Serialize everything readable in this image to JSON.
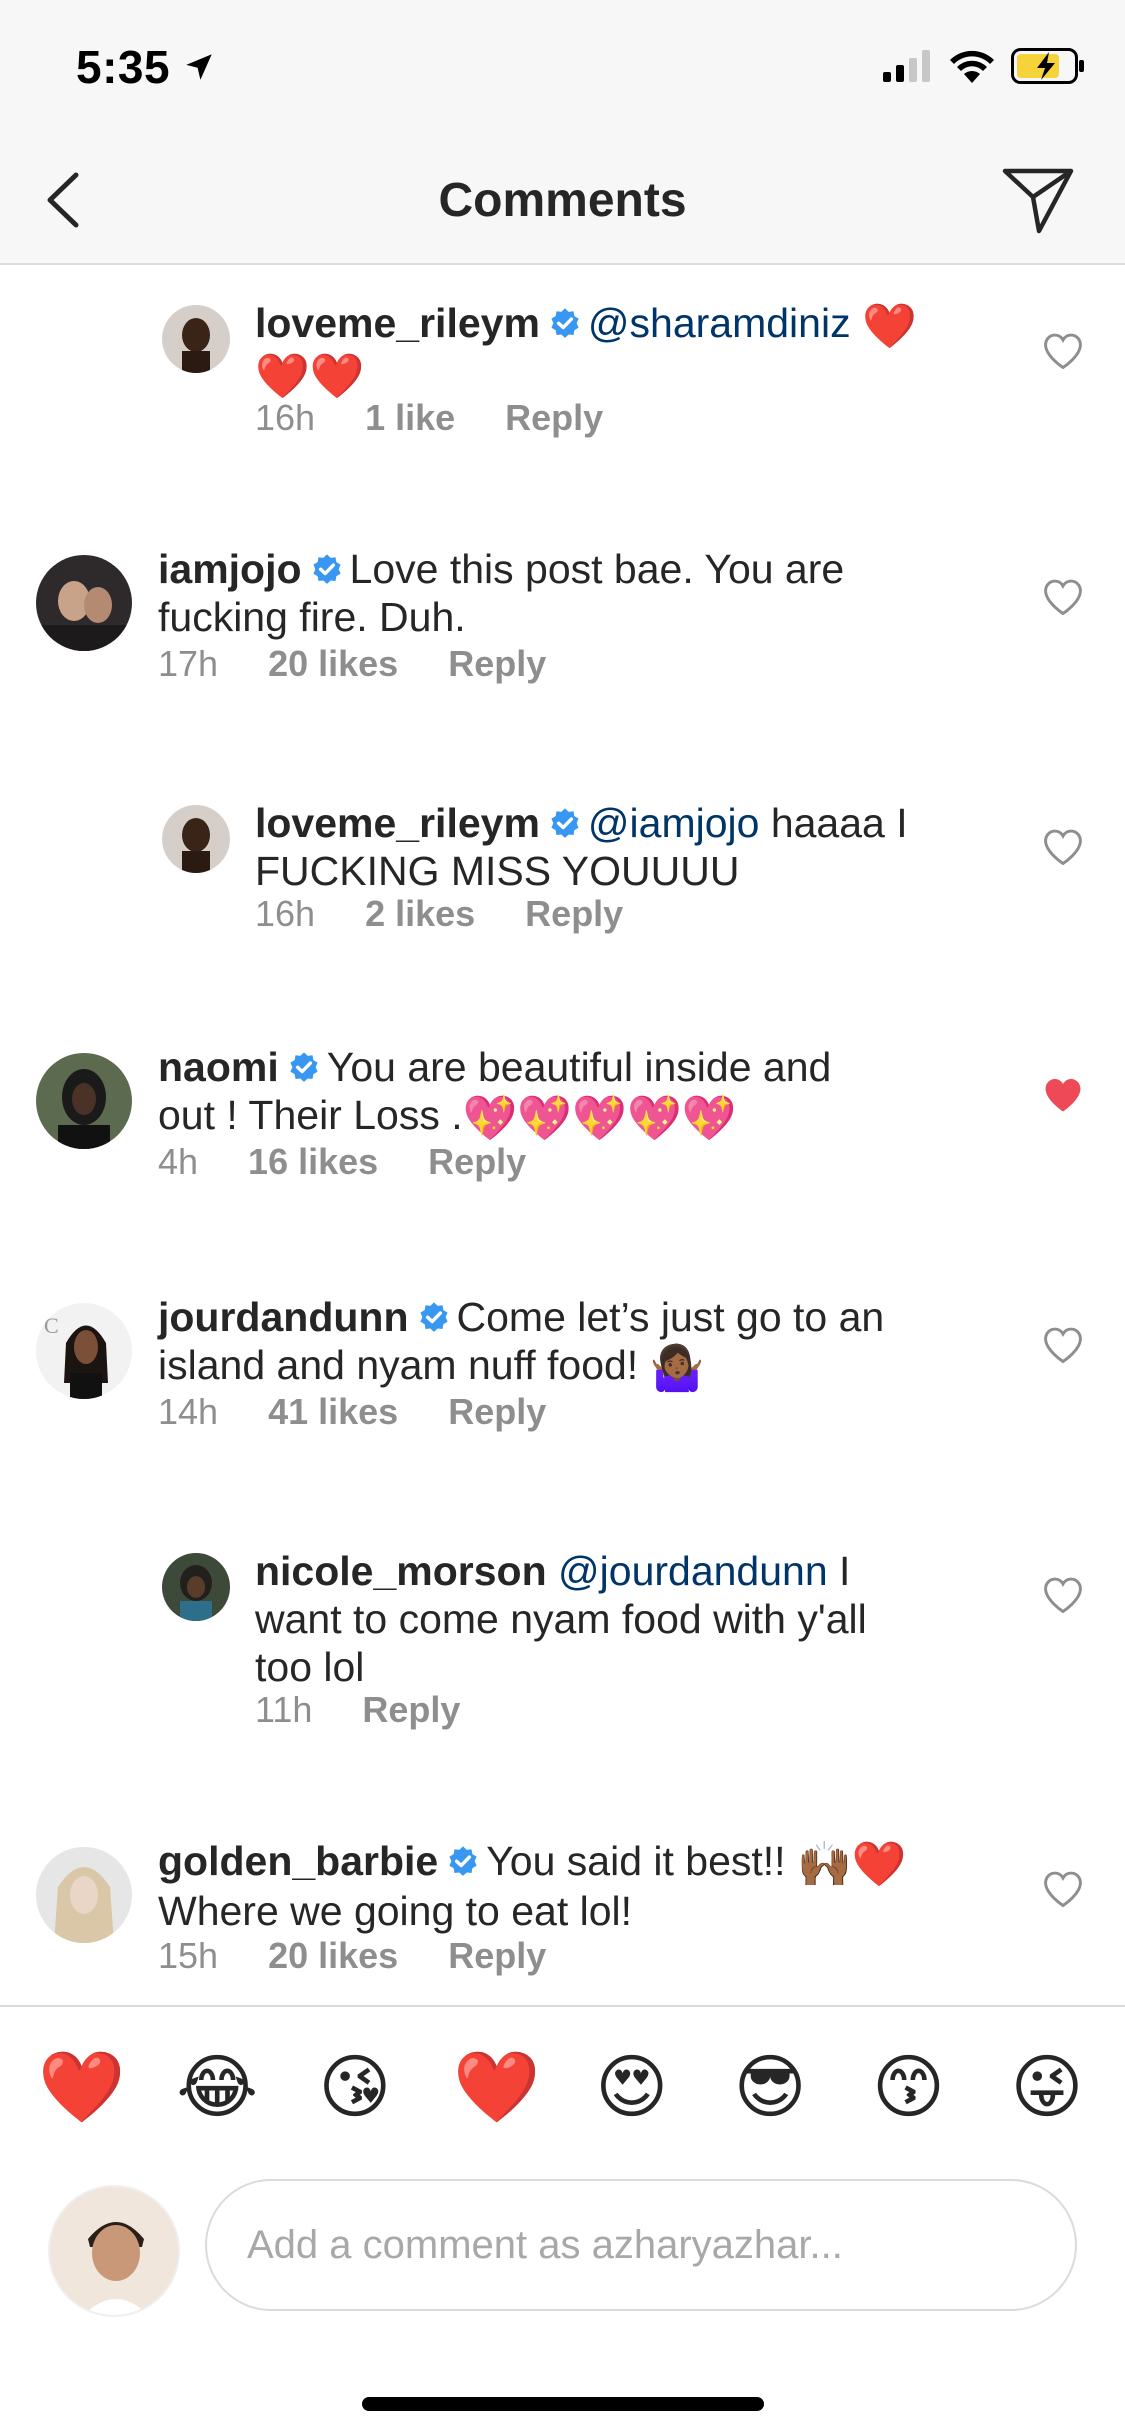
{
  "status_bar": {
    "time": "5:35"
  },
  "nav": {
    "title": "Comments"
  },
  "comments": [
    {
      "username": "loveme_rileym",
      "mention": "@sharamdiniz",
      "text_line1_emoji": "❤️",
      "text_line2": "❤️❤️",
      "time": "16h",
      "likes": "1 like",
      "reply": "Reply",
      "liked": false
    },
    {
      "username": "iamjojo",
      "text": "Love this post bae. You are",
      "text2": "fucking fire. Duh.",
      "time": "17h",
      "likes": "20 likes",
      "reply": "Reply",
      "liked": false
    },
    {
      "username": "loveme_rileym",
      "mention": "@iamjojo",
      "text": "haaaa I",
      "text2": "FUCKING MISS YOUUUU",
      "time": "16h",
      "likes": "2 likes",
      "reply": "Reply",
      "liked": false
    },
    {
      "username": "naomi",
      "text": "You are beautiful inside and",
      "text2": "out !  Their Loss .",
      "emojis": "💖💖💖💖💖",
      "time": "4h",
      "likes": "16 likes",
      "reply": "Reply",
      "liked": true
    },
    {
      "username": "jourdandunn",
      "text": "Come let’s just go to an",
      "text2": "island and nyam nuff food!",
      "emoji": "🤷🏾‍♀️",
      "time": "14h",
      "likes": "41 likes",
      "reply": "Reply",
      "liked": false
    },
    {
      "username": "nicole_morson",
      "mention": "@jourdandunn",
      "text": "I",
      "text2": "want to come nyam food with y'all",
      "text3": "too lol",
      "time": "11h",
      "reply": "Reply",
      "liked": false
    },
    {
      "username": "golden_barbie",
      "text": "You said it best!!",
      "emoji": "🙌🏾❤️",
      "text2": "Where we going to eat lol!",
      "time": "15h",
      "likes": "20 likes",
      "reply": "Reply",
      "liked": false
    }
  ],
  "reactions": [
    "❤️",
    "😂",
    "😘",
    "❤️",
    "😍",
    "😎",
    "😙",
    "😜"
  ],
  "composer": {
    "placeholder": "Add a comment as azharyazhar..."
  },
  "colors": {
    "verified": "#3897f0",
    "mention": "#003569",
    "liked_heart": "#ed4956",
    "meta": "#8e8e8e"
  }
}
